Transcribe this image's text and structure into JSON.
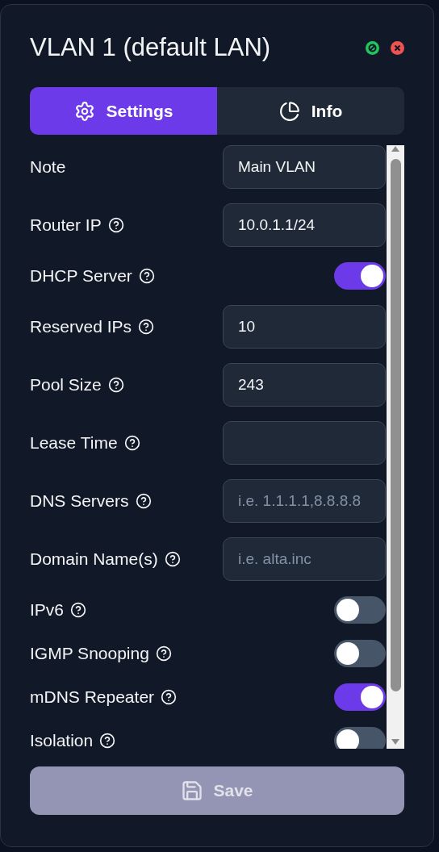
{
  "title": "VLAN 1 (default LAN)",
  "tabs": [
    {
      "label": "Settings",
      "selected": true
    },
    {
      "label": "Info",
      "selected": false
    }
  ],
  "fields": [
    {
      "kind": "input",
      "label": "Note",
      "help": false,
      "value": "Main VLAN"
    },
    {
      "kind": "input",
      "label": "Router IP",
      "help": true,
      "value": "10.0.1.1/24"
    },
    {
      "kind": "toggle",
      "label": "DHCP Server",
      "help": true,
      "on": true
    },
    {
      "kind": "input",
      "label": "Reserved IPs",
      "help": true,
      "value": "10"
    },
    {
      "kind": "input",
      "label": "Pool Size",
      "help": true,
      "value": "243"
    },
    {
      "kind": "input",
      "label": "Lease Time",
      "help": true
    },
    {
      "kind": "input",
      "label": "DNS Servers",
      "help": true,
      "placeholder": "i.e. 1.1.1.1,8.8.8.8"
    },
    {
      "kind": "input",
      "label": "Domain Name(s)",
      "help": true,
      "placeholder": "i.e. alta.inc"
    },
    {
      "kind": "toggle",
      "label": "IPv6",
      "help": true,
      "on": false
    },
    {
      "kind": "toggle",
      "label": "IGMP Snooping",
      "help": true,
      "on": false
    },
    {
      "kind": "toggle",
      "label": "mDNS Repeater",
      "help": true,
      "on": true
    },
    {
      "kind": "toggle",
      "label": "Isolation",
      "help": true,
      "on": false
    }
  ],
  "save": {
    "label": "Save",
    "disabled": true
  }
}
